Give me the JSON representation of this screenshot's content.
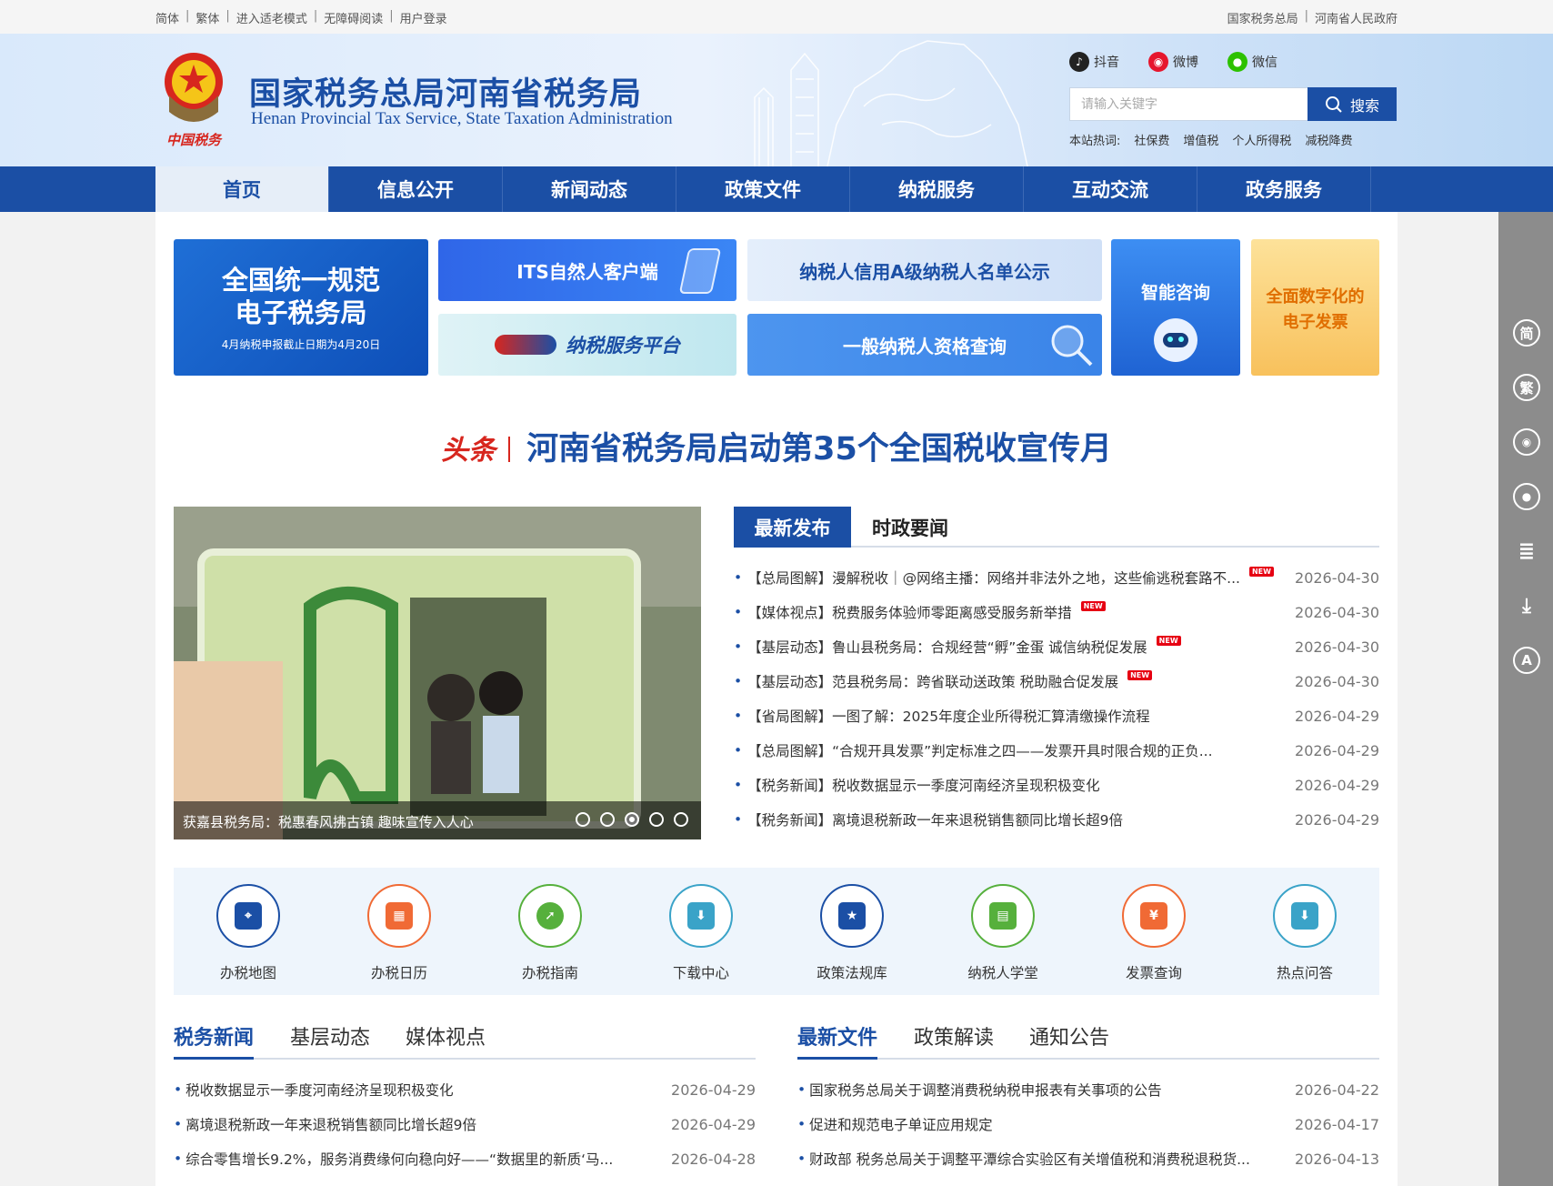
{
  "topbar": {
    "left": [
      "简体",
      "繁体",
      "进入适老模式",
      "无障碍阅读",
      "用户登录"
    ],
    "right": [
      "国家税务总局",
      "河南省人民政府"
    ]
  },
  "header": {
    "title": "国家税务总局河南省税务局",
    "subtitle": "Henan Provincial Tax Service, State Taxation Administration",
    "emblem_text": "中国税务",
    "social": [
      "抖音",
      "微博",
      "微信"
    ],
    "search_placeholder": "请输入关键字",
    "search_button": "搜索",
    "hot_label": "本站热词:",
    "hot_words": [
      "社保费",
      "增值税",
      "个人所得税",
      "减税降费"
    ]
  },
  "nav": [
    "首页",
    "信息公开",
    "新闻动态",
    "政策文件",
    "纳税服务",
    "互动交流",
    "政务服务"
  ],
  "tiles": {
    "etax_title_1": "全国统一规范",
    "etax_title_2": "电子税务局",
    "etax_note": "4月纳税申报截止日期为4月20日",
    "its": "ITS自然人客户端",
    "credit": "纳税人信用A级纳税人名单公示",
    "ai": "智能咨询",
    "invoice_1": "全面数字化的",
    "invoice_2": "电子发票",
    "platform": "纳税服务平台",
    "general": "一般纳税人资格查询"
  },
  "headline": {
    "tag": "头条",
    "text": "河南省税务局启动第35个全国税收宣传月"
  },
  "carousel": {
    "caption": "获嘉县税务局：税惠春风拂古镇 趣味宣传入人心",
    "slide_count": 5,
    "active": 3
  },
  "latest_tabs": [
    "最新发布",
    "时政要闻"
  ],
  "latest_news": [
    {
      "title": "【总局图解】漫解税收｜@网络主播：网络并非法外之地，这些偷逃税套路不...",
      "new": "NEW",
      "date": "2026-04-30"
    },
    {
      "title": "【媒体视点】税费服务体验师零距离感受服务新举措",
      "new": "NEW",
      "date": "2026-04-30"
    },
    {
      "title": "【基层动态】鲁山县税务局：合规经营“孵”金蛋 诚信纳税促发展",
      "new": "NEW",
      "date": "2026-04-30"
    },
    {
      "title": "【基层动态】范县税务局：跨省联动送政策 税助融合促发展",
      "new": "NEW",
      "date": "2026-04-30"
    },
    {
      "title": "【省局图解】一图了解：2025年度企业所得税汇算清缴操作流程",
      "new": "",
      "date": "2026-04-29"
    },
    {
      "title": "【总局图解】“合规开具发票”判定标准之四——发票开具时限合规的正负...",
      "new": "",
      "date": "2026-04-29"
    },
    {
      "title": "【税务新闻】税收数据显示一季度河南经济呈现积极变化",
      "new": "",
      "date": "2026-04-29"
    },
    {
      "title": "【税务新闻】离境退税新政一年来退税销售额同比增长超9倍",
      "new": "",
      "date": "2026-04-29"
    }
  ],
  "services": [
    "办税地图",
    "办税日历",
    "办税指南",
    "下载中心",
    "政策法规库",
    "纳税人学堂",
    "发票查询",
    "热点问答"
  ],
  "tax_tabs": [
    "税务新闻",
    "基层动态",
    "媒体视点"
  ],
  "tax_news": [
    {
      "title": "税收数据显示一季度河南经济呈现积极变化",
      "date": "2026-04-29"
    },
    {
      "title": "离境退税新政一年来退税销售额同比增长超9倍",
      "date": "2026-04-29"
    },
    {
      "title": "综合零售增长9.2%，服务消费缘何向稳向好——“数据里的新质‘马...",
      "date": "2026-04-28"
    }
  ],
  "file_tabs": [
    "最新文件",
    "政策解读",
    "通知公告"
  ],
  "file_news": [
    {
      "title": "国家税务总局关于调整消费税纳税申报表有关事项的公告",
      "date": "2026-04-22"
    },
    {
      "title": "促进和规范电子单证应用规定",
      "date": "2026-04-17"
    },
    {
      "title": "财政部 税务总局关于调整平潭综合实验区有关增值税和消费税退税货...",
      "date": "2026-04-13"
    }
  ],
  "sidebar": [
    "简",
    "繁",
    "微博",
    "微信",
    "读屏",
    "下载",
    "A"
  ],
  "colors": {
    "primary": "#1b4fa5",
    "accent_red": "#d7261e",
    "sidebar": "#8c8c8c"
  }
}
